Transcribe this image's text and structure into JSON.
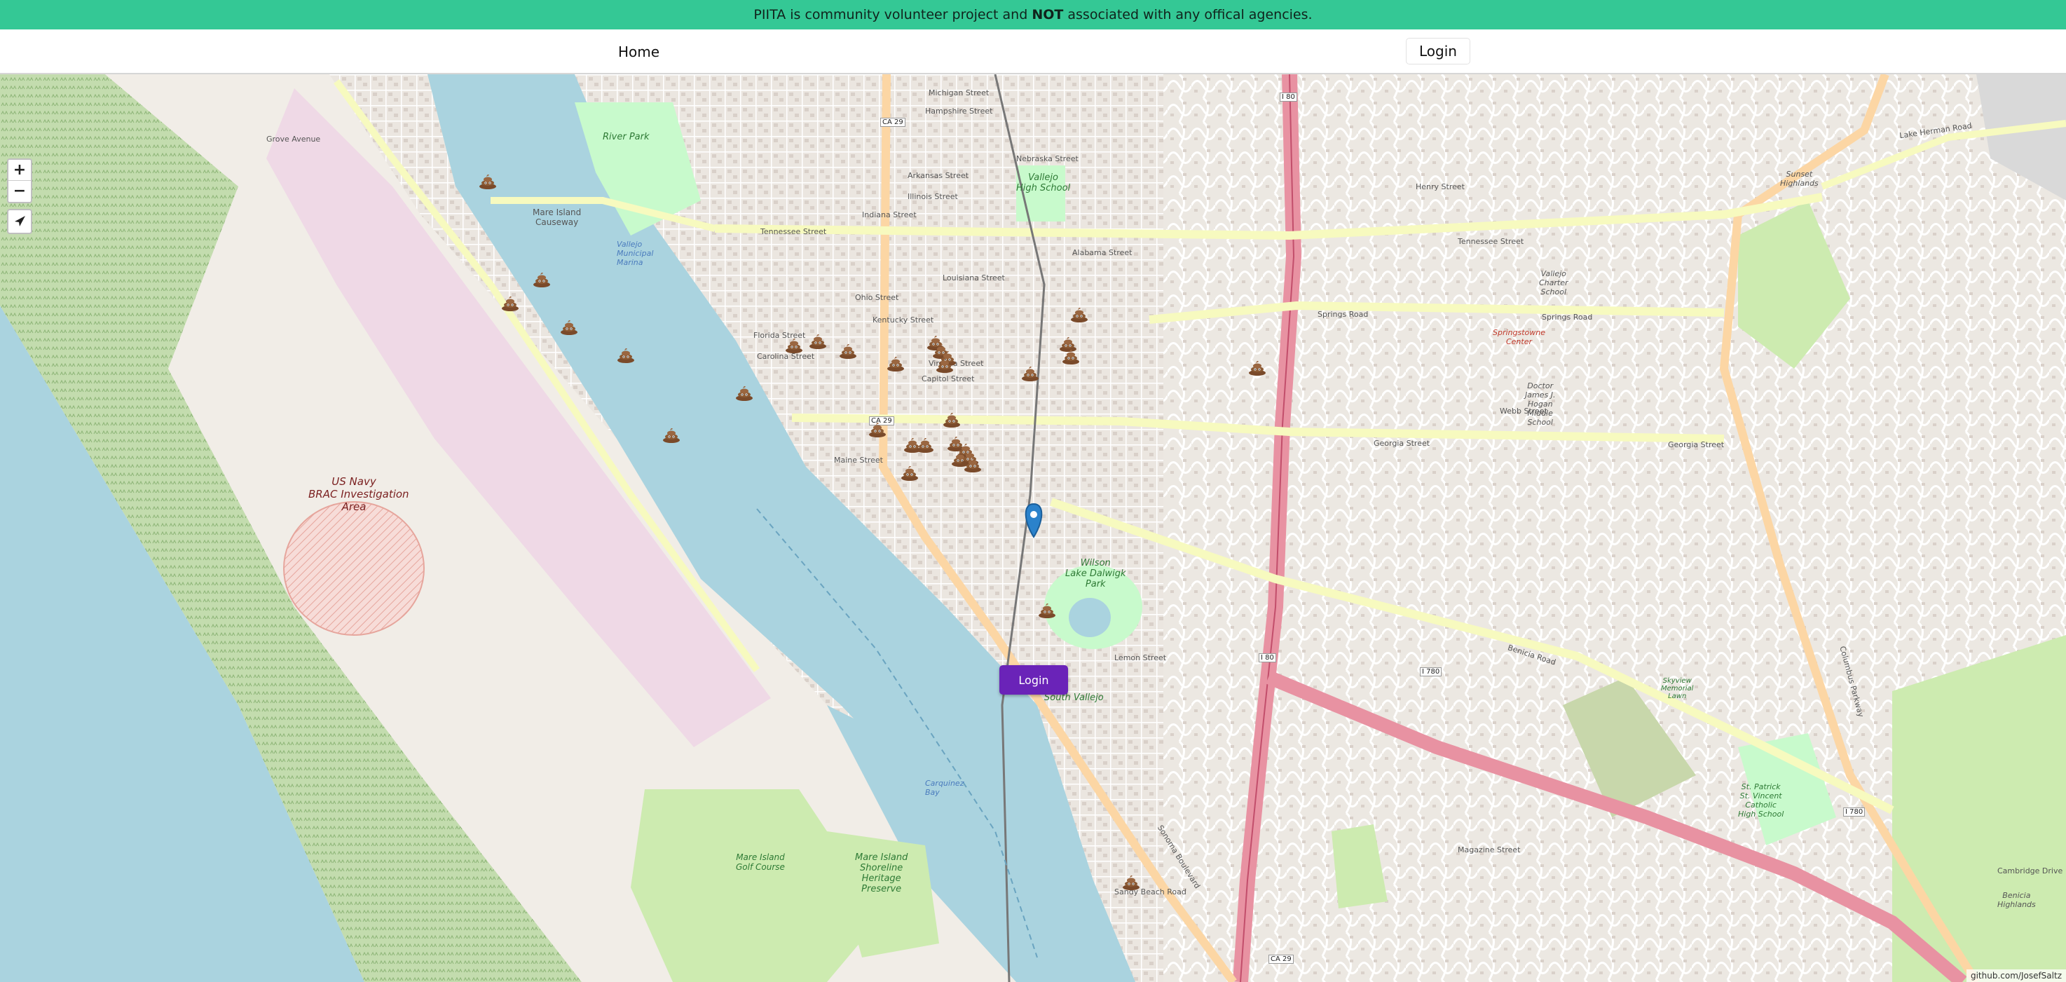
{
  "banner": {
    "text_before": "PIITA is community volunteer project and ",
    "text_bold": "NOT",
    "text_after": " associated with any offical agencies."
  },
  "nav": {
    "home": "Home",
    "login": "Login"
  },
  "map": {
    "zoom_in": "+",
    "zoom_out": "−",
    "locate_icon": "locate-arrow-icon",
    "marker_icon": "poo-marker-icon",
    "login_button": "Login",
    "attribution": "github.com/JosefSaltz",
    "colors": {
      "banner": "#34c895",
      "water": "#aad3df",
      "park": "#c8facc",
      "wetland": "#b5d29f",
      "motorway": "#e892a2",
      "primary": "#fcd6a4",
      "secondary": "#f7fabf",
      "login_button": "#6a23b8"
    },
    "labels": {
      "us_navy_1": "US Navy",
      "us_navy_2": "BRAC Investigation",
      "us_navy_3": "Area",
      "mare_island_causeway_1": "Mare Island",
      "mare_island_causeway_2": "Causeway",
      "river_park": "River Park",
      "vallejo_municipal_marina": "Vallejo Municipal Marina",
      "vallejo_high_school_1": "Vallejo",
      "vallejo_high_school_2": "High School",
      "wilson_lake_1": "Wilson",
      "wilson_lake_2": "Lake Dalwigk",
      "wilson_lake_3": "Park",
      "south_vallejo": "South Vallejo",
      "golf_1": "Mare Island",
      "golf_2": "Golf Course",
      "preserve_1": "Mare Island",
      "preserve_2": "Shoreline",
      "preserve_3": "Heritage",
      "preserve_4": "Preserve",
      "carquinez_bay_1": "Carquinez",
      "carquinez_bay_2": "Bay",
      "springstowne_1": "Springstowne",
      "springstowne_2": "Center",
      "vallejo_charter_1": "Vallejo",
      "vallejo_charter_2": "Charter",
      "vallejo_charter_3": "School",
      "hogan_1": "Doctor",
      "hogan_2": "James J.",
      "hogan_3": "Hogan",
      "hogan_4": "Middle",
      "hogan_5": "School",
      "tennessee_street": "Tennessee Street",
      "springs_road": "Springs Road",
      "georgia_street": "Georgia Street",
      "benicia_road": "Benicia Road",
      "grove_avenue": "Grove Avenue",
      "lake_herman_road": "Lake Herman Road",
      "columbus_parkway": "Columbus Parkway",
      "sonoma_boulevard": "Sonoma Boulevard",
      "i80": "I 80",
      "i780": "I 780",
      "ca29": "CA 29",
      "nebraska_street": "Nebraska Street",
      "florida_street": "Florida Street",
      "virginia_street": "Virginia Street",
      "maine_street": "Maine Street",
      "kentucky_street": "Kentucky Street",
      "ohio_street": "Ohio Street",
      "louisiana_street": "Louisiana Street",
      "indiana_street": "Indiana Street",
      "alabama_street": "Alabama Street",
      "capitol_street": "Capitol Street",
      "carolina_street": "Carolina Street",
      "illinois_street": "Illinois Street",
      "arkansas_street": "Arkansas Street",
      "michigan_street": "Michigan Street",
      "hampshire_street": "Hampshire Street",
      "henry_street": "Henry Street",
      "webb_street": "Webb Street",
      "lemon_street": "Lemon Street",
      "magazine_street": "Magazine Street",
      "sandy_beach_road": "Sandy Beach Road",
      "st_vincent_1": "St. Patrick",
      "st_vincent_2": "St. Vincent",
      "st_vincent_3": "Catholic",
      "st_vincent_4": "High School",
      "benicia_highlands_1": "Benicia",
      "benicia_highlands_2": "Highlands",
      "skyview_1": "Skyview",
      "skyview_2": "Memorial",
      "skyview_3": "Lawn",
      "sunset_1": "Sunset",
      "sunset_2": "Highlands",
      "cambridge_drive": "Cambridge Drive"
    }
  }
}
